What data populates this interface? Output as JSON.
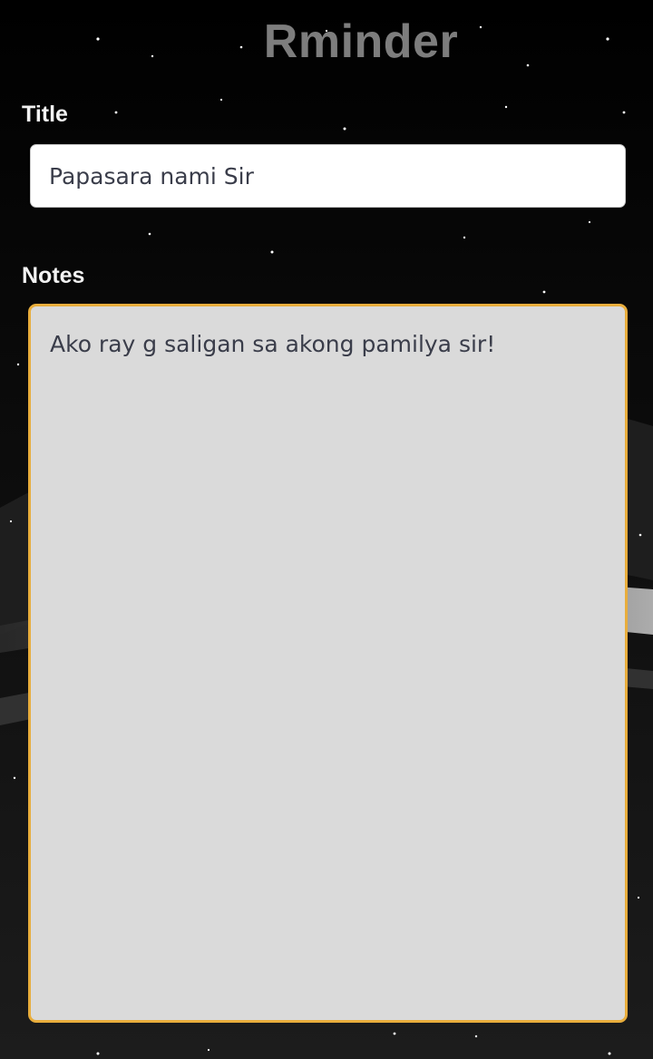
{
  "app": {
    "title": "Rminder"
  },
  "form": {
    "title_label": "Title",
    "title_value": "Papasara nami Sir",
    "notes_label": "Notes",
    "notes_value": "Ako ray g saligan sa akong pamilya sir!"
  },
  "colors": {
    "background": "#000000",
    "app_title": "#7d7d7d",
    "label": "#f2f2f2",
    "input_bg": "#ffffff",
    "notes_bg": "#dadada",
    "focus_border": "#e8ad3c",
    "input_text": "#3a3d4a"
  }
}
